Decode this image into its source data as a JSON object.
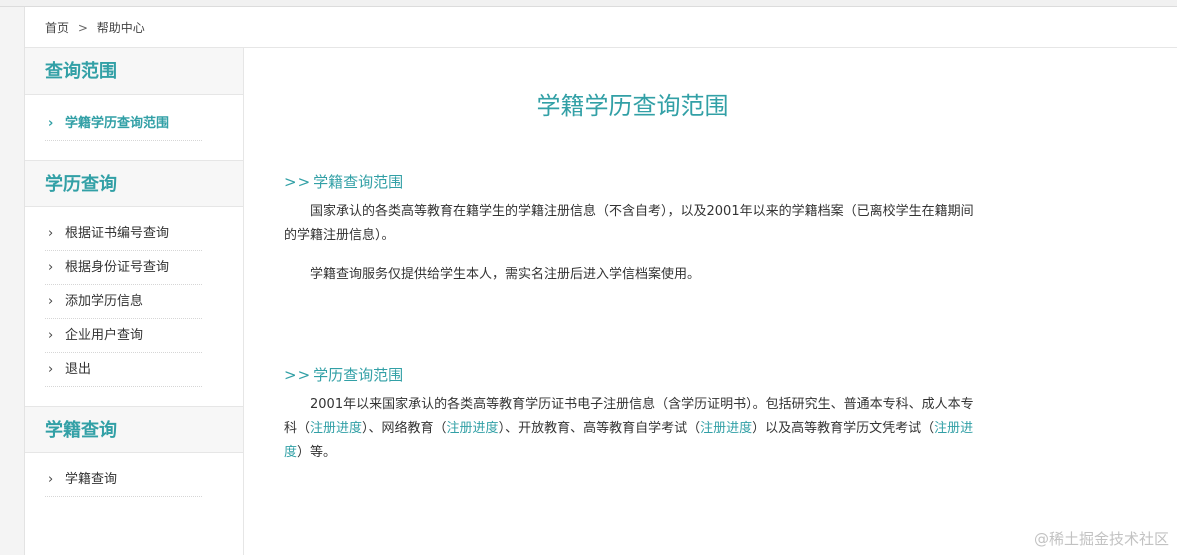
{
  "breadcrumb": {
    "home": "首页",
    "separator": ">",
    "current": "帮助中心"
  },
  "sidebar": {
    "sections": [
      {
        "title": "查询范围",
        "items": [
          "学籍学历查询范围"
        ]
      },
      {
        "title": "学历查询",
        "items": [
          "根据证书编号查询",
          "根据身份证号查询",
          "添加学历信息",
          "企业用户查询",
          "退出"
        ]
      },
      {
        "title": "学籍查询",
        "items": [
          "学籍查询"
        ]
      }
    ],
    "arrow": "›"
  },
  "main": {
    "title": "学籍学历查询范围",
    "chevron": ">>",
    "section1": {
      "heading": "学籍查询范围",
      "para1": "国家承认的各类高等教育在籍学生的学籍注册信息（不含自考），以及2001年以来的学籍档案（已离校学生在籍期间的学籍注册信息）。",
      "para2": "学籍查询服务仅提供给学生本人，需实名注册后进入学信档案使用。"
    },
    "section2": {
      "heading": "学历查询范围",
      "seg1": "2001年以来国家承认的各类高等教育学历证书电子注册信息（含学历证明书）。包括研究生、普通本专科、成人本专科（",
      "link": "注册进度",
      "seg2": "）、网络教育（",
      "seg3": "）、开放教育、高等教育自学考试（",
      "seg4": "）以及高等教育学历文凭考试（",
      "seg5": "）等。"
    }
  },
  "watermark": "@稀土掘金技术社区",
  "colors": {
    "accent": "#32a0a6",
    "text": "#333333",
    "border": "#e6e6e6"
  }
}
